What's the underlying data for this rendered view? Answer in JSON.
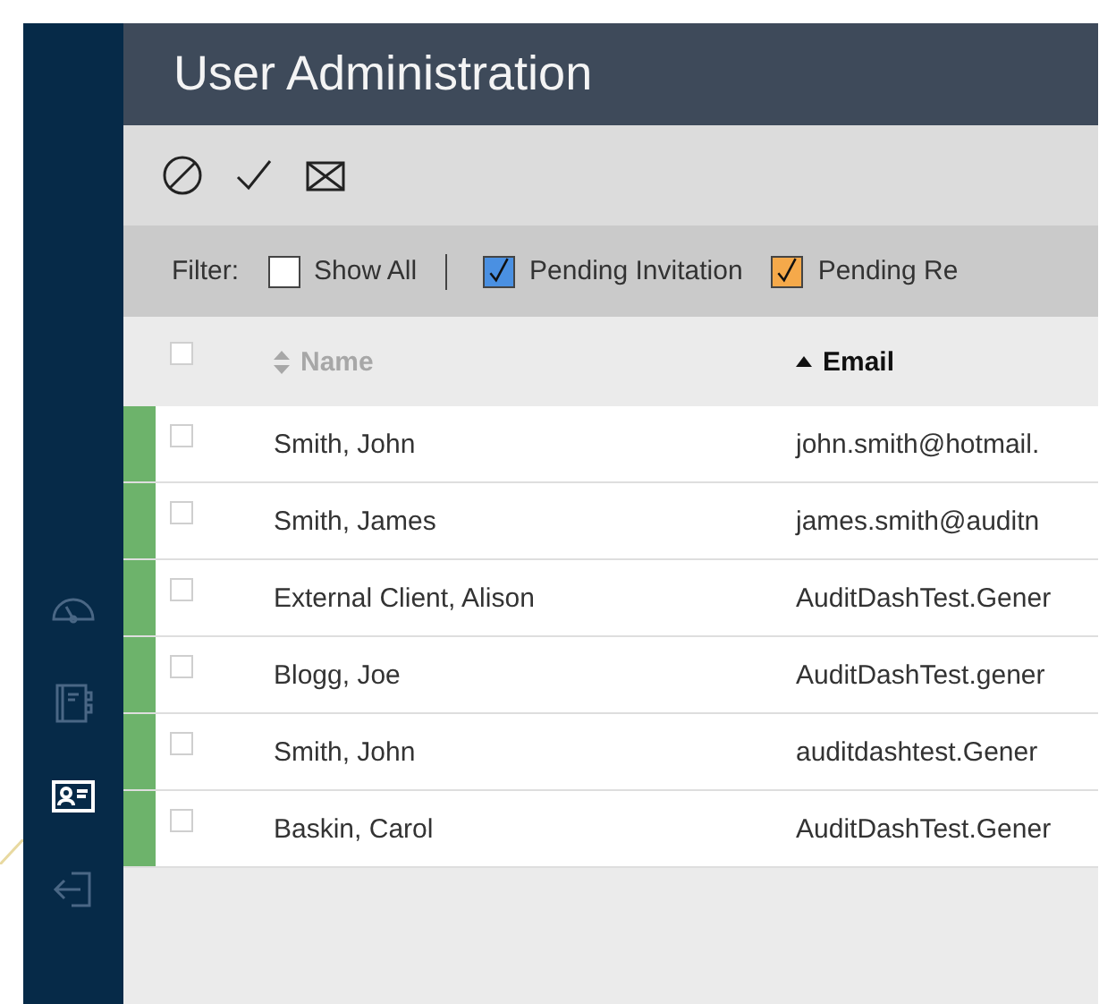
{
  "sidebar": {
    "items": [
      {
        "kind": "gauge",
        "selected": false
      },
      {
        "kind": "notebook",
        "selected": false
      },
      {
        "kind": "contact-card",
        "selected": true
      },
      {
        "kind": "logout",
        "selected": false
      }
    ]
  },
  "header": {
    "title": "User Administration"
  },
  "toolbar": {
    "buttons": [
      {
        "kind": "block"
      },
      {
        "kind": "approve"
      },
      {
        "kind": "mail"
      }
    ]
  },
  "filter": {
    "label": "Filter:",
    "options": [
      {
        "label": "Show All",
        "checked": false,
        "color": "#ffffff"
      },
      {
        "label": "Pending Invitation",
        "checked": true,
        "color": "#4a90e2"
      },
      {
        "label": "Pending Re",
        "checked": true,
        "color": "#f5a94a"
      }
    ]
  },
  "table": {
    "select_all": {
      "checked": false
    },
    "columns": [
      {
        "label": "Name",
        "sorted": false,
        "active": false
      },
      {
        "label": "Email",
        "sorted": true,
        "active": true
      }
    ],
    "rows": [
      {
        "color": "#6db36b",
        "checked": false,
        "name": "Smith, John",
        "email": "john.smith@hotmail."
      },
      {
        "color": "#6db36b",
        "checked": false,
        "name": "Smith, James",
        "email": "james.smith@auditn"
      },
      {
        "color": "#6db36b",
        "checked": false,
        "name": "External Client, Alison",
        "email": "AuditDashTest.Gener"
      },
      {
        "color": "#6db36b",
        "checked": false,
        "name": "Blogg, Joe",
        "email": "AuditDashTest.gener"
      },
      {
        "color": "#6db36b",
        "checked": false,
        "name": "Smith, John",
        "email": "auditdashtest.Gener"
      },
      {
        "color": "#6db36b",
        "checked": false,
        "name": "Baskin, Carol",
        "email": "AuditDashTest.Gener"
      }
    ]
  }
}
